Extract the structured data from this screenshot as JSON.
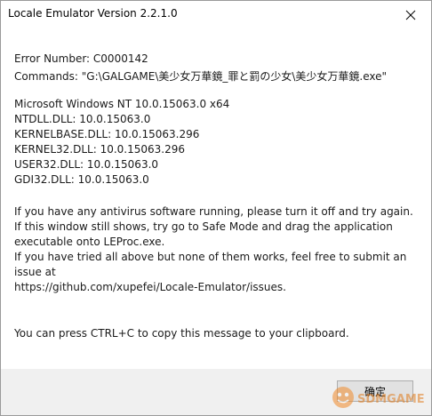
{
  "window": {
    "title": "Locale Emulator Version 2.2.1.0"
  },
  "message": {
    "error_number": "Error Number: C0000142",
    "commands": "Commands: \"G:\\GALGAME\\美少女万華鏡_罪と罰の少女\\美少女万華鏡.exe\"",
    "os": "Microsoft Windows NT 10.0.15063.0 x64",
    "ntdll": "NTDLL.DLL: 10.0.15063.0",
    "kernelbase": "KERNELBASE.DLL: 10.0.15063.296",
    "kernel32": "KERNEL32.DLL: 10.0.15063.296",
    "user32": "USER32.DLL: 10.0.15063.0",
    "gdi32": "GDI32.DLL: 10.0.15063.0",
    "advice_line1": "If you have any antivirus software running, please turn it off and try again.",
    "advice_line2": "If this window still shows, try go to Safe Mode and drag the application",
    "advice_line3": "executable onto LEProc.exe.",
    "advice_line4": "If you have tried all above but none of them works, feel free to submit an",
    "advice_line5": "issue at",
    "issue_url": "https://github.com/xupefei/Locale-Emulator/issues.",
    "clipboard_hint": "You can press CTRL+C to copy this message to your clipboard."
  },
  "footer": {
    "ok_label": "确定"
  },
  "watermark": {
    "text": "SDMGAME"
  }
}
